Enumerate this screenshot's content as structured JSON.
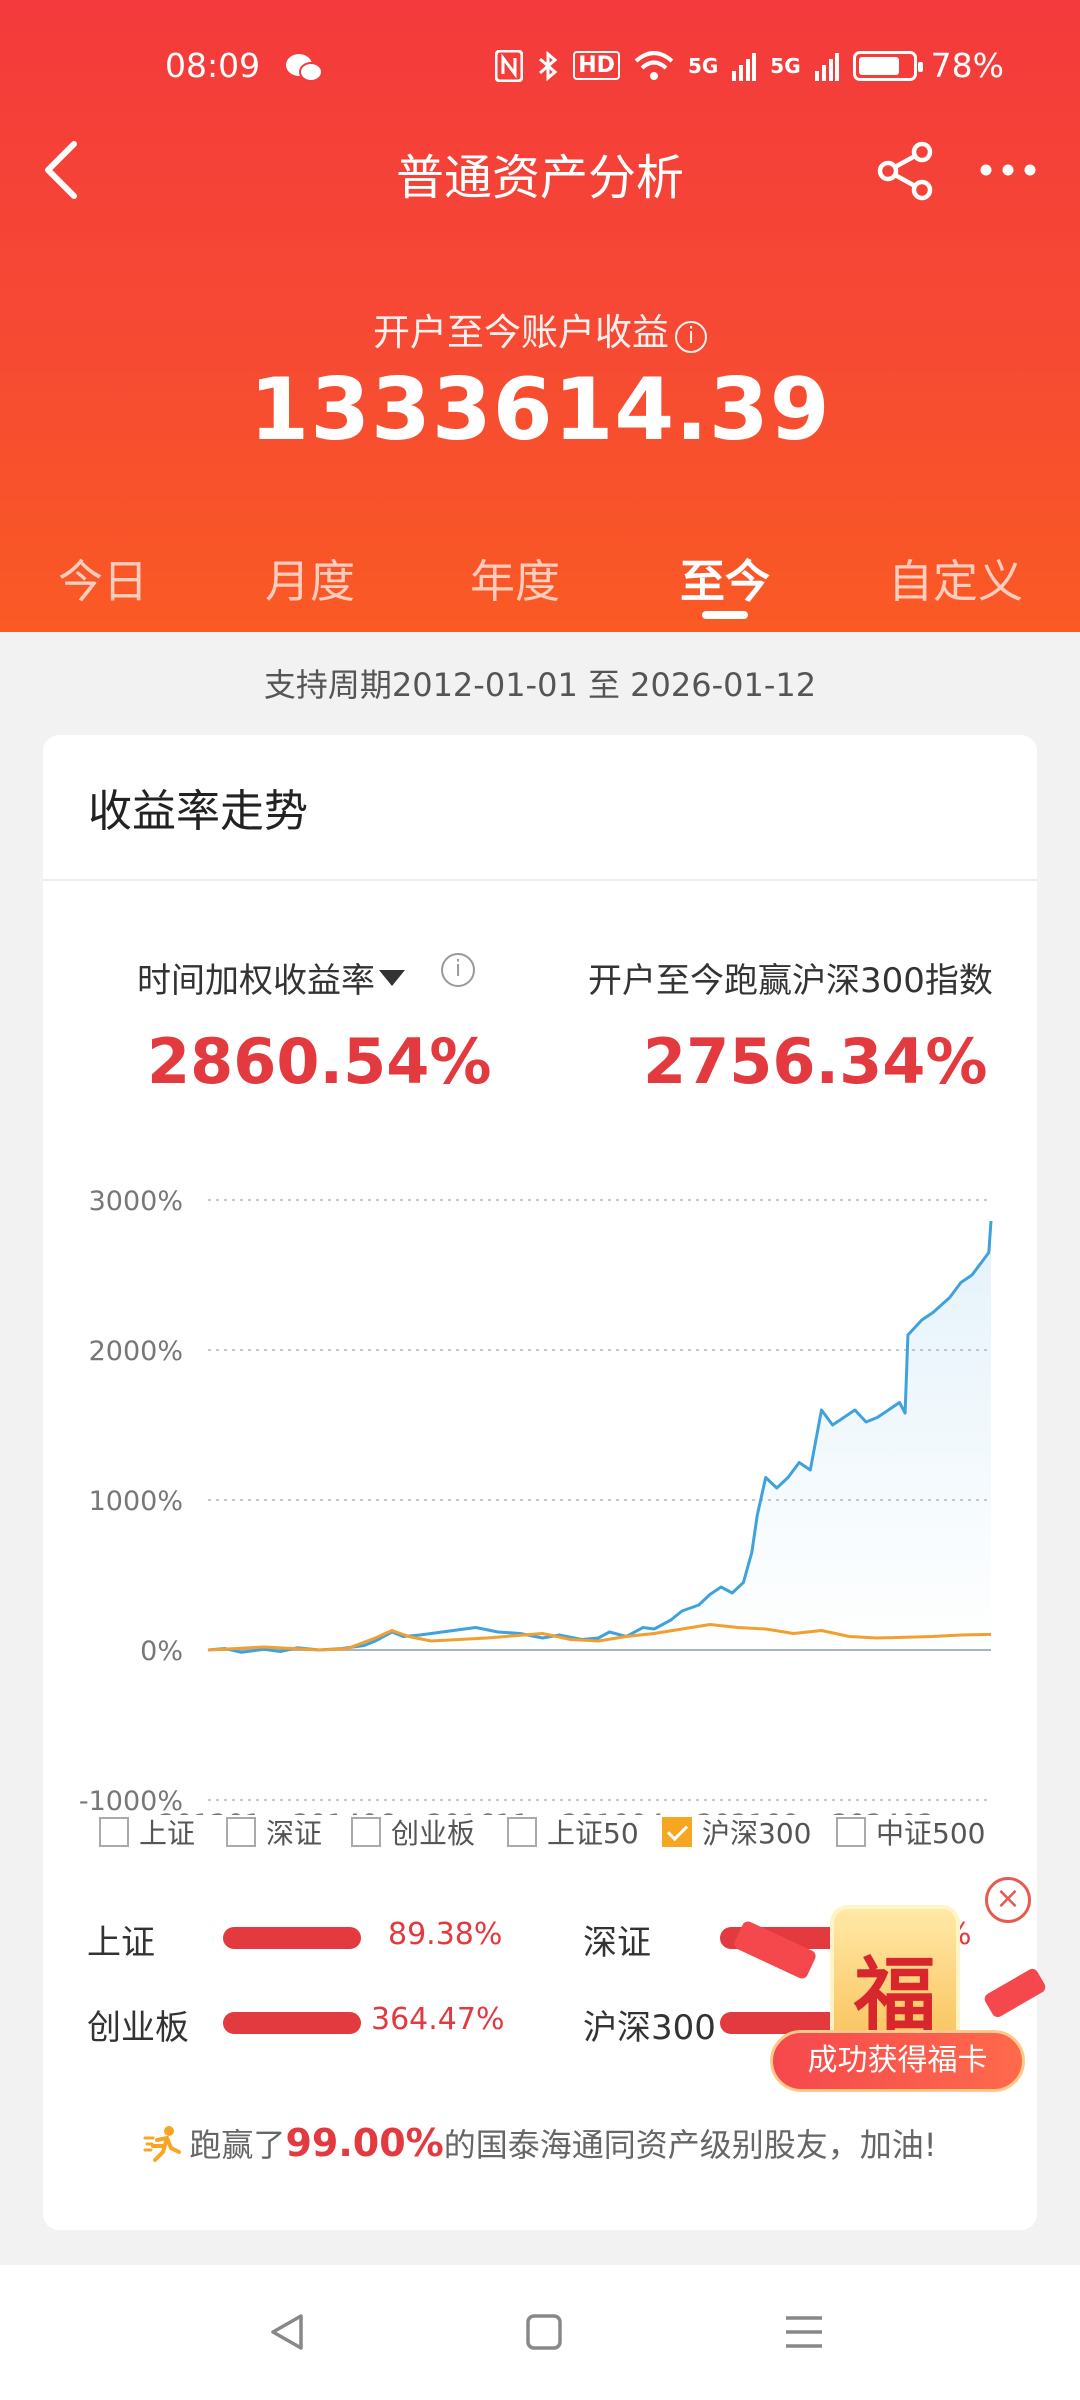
{
  "status_bar": {
    "time": "08:09",
    "network_hd": "HD",
    "network_5g_1": "5G",
    "network_5g_2": "5G",
    "battery": "78%",
    "battery_level": 0.78,
    "icons": [
      "wechat-icon",
      "nfc-icon",
      "bluetooth-icon",
      "wifi-icon",
      "signal-icon",
      "battery-icon"
    ]
  },
  "nav": {
    "title": "普通资产分析",
    "icons": [
      "back-icon",
      "share-icon",
      "more-icon"
    ]
  },
  "summary": {
    "label": "开户至今账户收益",
    "value": "1333614.39"
  },
  "tabs": [
    {
      "label": "今日",
      "active": false
    },
    {
      "label": "月度",
      "active": false
    },
    {
      "label": "年度",
      "active": false
    },
    {
      "label": "至今",
      "active": true
    },
    {
      "label": "自定义",
      "active": false
    }
  ],
  "period": "支持周期2012-01-01 至 2026-01-12",
  "card": {
    "title": "收益率走势",
    "metric_left_label": "时间加权收益率",
    "metric_left_value": "2860.54%",
    "metric_right_label": "开户至今跑赢沪深300指数",
    "metric_right_value": "2756.34%"
  },
  "chart_data": {
    "type": "line",
    "ylim": [
      -1000,
      3000
    ],
    "yticks": [
      "3000%",
      "2000%",
      "1000%",
      "0%",
      "-1000%"
    ],
    "ytick_values": [
      3000,
      2000,
      1000,
      0,
      -1000
    ],
    "xticks": [
      "201201",
      "201406",
      "201611",
      "201904",
      "202109",
      "202402"
    ],
    "x_range": [
      2012.0,
      2026.04
    ],
    "grid": true,
    "colors": {
      "portfolio": "#3fa2dd",
      "hs300": "#f0a030",
      "zero": "#aab4c8"
    },
    "series": [
      {
        "name": "",
        "color": "#3fa2dd",
        "x": [
          2012.0,
          2012.3,
          2012.6,
          2013.0,
          2013.3,
          2013.6,
          2014.0,
          2014.4,
          2014.8,
          2015.0,
          2015.3,
          2015.5,
          2015.8,
          2016.0,
          2016.4,
          2016.8,
          2017.2,
          2017.6,
          2018.0,
          2018.3,
          2018.7,
          2019.0,
          2019.2,
          2019.5,
          2019.8,
          2020.0,
          2020.3,
          2020.5,
          2020.8,
          2021.0,
          2021.2,
          2021.4,
          2021.6,
          2021.75,
          2021.85,
          2022.0,
          2022.2,
          2022.4,
          2022.6,
          2022.8,
          2023.0,
          2023.2,
          2023.4,
          2023.6,
          2023.8,
          2024.0,
          2024.2,
          2024.4,
          2024.5,
          2024.55,
          2024.8,
          2025.0,
          2025.3,
          2025.5,
          2025.7,
          2025.9,
          2026.0,
          2026.04
        ],
        "y": [
          0,
          10,
          -15,
          5,
          -10,
          15,
          0,
          10,
          30,
          60,
          120,
          90,
          100,
          110,
          130,
          150,
          120,
          110,
          80,
          100,
          70,
          80,
          120,
          90,
          150,
          140,
          200,
          260,
          300,
          370,
          420,
          380,
          450,
          650,
          900,
          1150,
          1080,
          1150,
          1250,
          1200,
          1600,
          1500,
          1550,
          1600,
          1520,
          1550,
          1600,
          1650,
          1580,
          2100,
          2200,
          2250,
          2350,
          2450,
          2500,
          2600,
          2650,
          2860
        ]
      },
      {
        "name": "沪深300",
        "color": "#f0a030",
        "x": [
          2012.0,
          2013.0,
          2014.0,
          2014.5,
          2015.0,
          2015.3,
          2015.6,
          2016.0,
          2017.0,
          2018.0,
          2018.5,
          2019.0,
          2019.5,
          2020.0,
          2020.5,
          2021.0,
          2021.5,
          2022.0,
          2022.5,
          2023.0,
          2023.5,
          2024.0,
          2024.5,
          2025.0,
          2025.5,
          2026.04
        ],
        "y": [
          0,
          20,
          0,
          10,
          80,
          130,
          90,
          60,
          80,
          110,
          70,
          60,
          90,
          110,
          140,
          170,
          150,
          140,
          110,
          130,
          90,
          80,
          85,
          90,
          100,
          104
        ]
      }
    ]
  },
  "legend": [
    {
      "label": "上证",
      "checked": false
    },
    {
      "label": "深证",
      "checked": false
    },
    {
      "label": "创业板",
      "checked": false
    },
    {
      "label": "上证50",
      "checked": false
    },
    {
      "label": "沪深300",
      "checked": true
    },
    {
      "label": "中证500",
      "checked": false
    }
  ],
  "comparisons": [
    {
      "label": "上证",
      "value": "89.38%"
    },
    {
      "label": "深证",
      "value": "%"
    },
    {
      "label": "创业板",
      "value": "364.47%"
    },
    {
      "label": "沪深300",
      "value": ""
    }
  ],
  "beat": {
    "prefix": "跑赢了",
    "value": "99.00%",
    "suffix": "的国泰海通同资产级别股友，加油!"
  },
  "popup": {
    "card_char": "福",
    "button_label": "成功获得福卡",
    "close_icon": "close-icon"
  },
  "bottom_nav": [
    "back-triangle-icon",
    "home-square-icon",
    "menu-lines-icon"
  ]
}
